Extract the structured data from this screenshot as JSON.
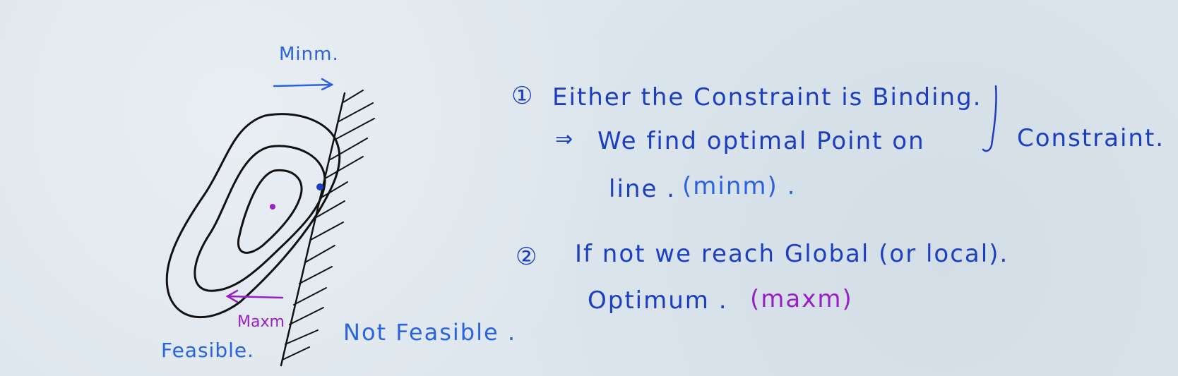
{
  "labels": {
    "minm": "Minm.",
    "maxm": "Maxm",
    "feasible": "Feasible.",
    "not_feasible": "Not Feasible ."
  },
  "notes": [
    {
      "number": "①",
      "text": "Either the Constraint is Binding.",
      "arrow": "⇒",
      "subtext": "We find optimal Point on",
      "subtext_right": "Constraint.",
      "line2": "line .",
      "line2_tag": "(minm) ."
    },
    {
      "number": "②",
      "text": "If not we reach Global (or local).",
      "line2": "Optimum .",
      "line2_tag": "(maxm)"
    }
  ],
  "colors": {
    "ink_black": "#111111",
    "ink_blue": "#1c3fc2",
    "ink_light_blue": "#2a63e0",
    "ink_purple": "#9a1fc8",
    "paper": "#dde6ed"
  }
}
